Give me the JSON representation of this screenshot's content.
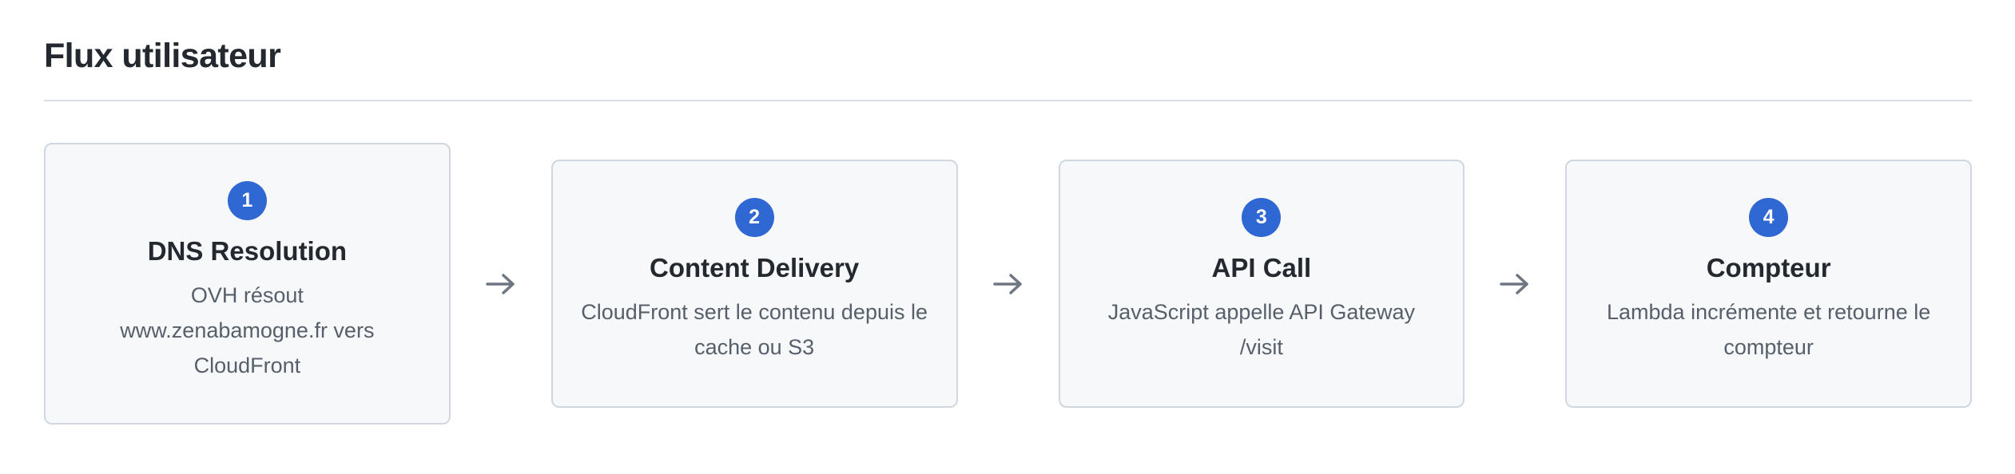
{
  "title": "Flux utilisateur",
  "steps": [
    {
      "number": "1",
      "title": "DNS Resolution",
      "description": "OVH résout www.zenabamogne.fr vers CloudFront"
    },
    {
      "number": "2",
      "title": "Content Delivery",
      "description": "CloudFront sert le contenu depuis le cache ou S3"
    },
    {
      "number": "3",
      "title": "API Call",
      "description": "JavaScript appelle API Gateway /visit"
    },
    {
      "number": "4",
      "title": "Compteur",
      "description": "Lambda incrémente et retourne le compteur"
    }
  ],
  "icons": {
    "connector": "arrow-right-icon"
  },
  "colors": {
    "accent": "#2f67d3",
    "card_background": "#f6f8fa",
    "card_border": "#d0d7de",
    "title_text": "#24292f",
    "description_text": "#57606a",
    "arrow": "#6e7781"
  }
}
